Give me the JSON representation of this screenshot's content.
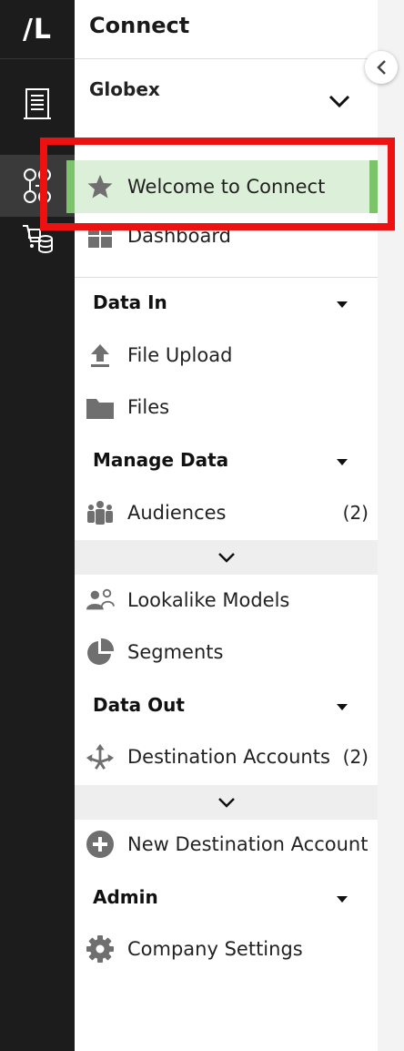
{
  "app": {
    "logo_text": "/L",
    "title": "Connect",
    "org_name": "Globex"
  },
  "rail": {
    "items": [
      {
        "icon": "building-icon"
      },
      {
        "icon": "connect-nodes-icon",
        "active": true
      },
      {
        "icon": "cart-database-icon"
      }
    ]
  },
  "nav": {
    "welcome": {
      "label": "Welcome to Connect",
      "icon": "star-icon"
    },
    "dashboard": {
      "label": "Dashboard",
      "icon": "dashboard-icon"
    },
    "sections": [
      {
        "title": "Data In"
      },
      {
        "title": "Manage Data"
      },
      {
        "title": "Data Out"
      },
      {
        "title": "Admin"
      }
    ],
    "file_upload": {
      "label": "File Upload",
      "icon": "upload-icon"
    },
    "files": {
      "label": "Files",
      "icon": "folder-icon"
    },
    "audiences": {
      "label": "Audiences",
      "count": "(2)",
      "icon": "people-icon"
    },
    "lookalike": {
      "label": "Lookalike Models",
      "icon": "lookalike-icon"
    },
    "segments": {
      "label": "Segments",
      "icon": "pie-icon"
    },
    "destinations": {
      "label": "Destination Accounts",
      "count": "(2)",
      "icon": "share-arrows-icon"
    },
    "new_destination": {
      "label": "New Destination Account",
      "icon": "plus-circle-icon"
    },
    "company_settings": {
      "label": "Company Settings",
      "icon": "gear-icon"
    }
  },
  "colors": {
    "rail_bg": "#1c1c1c",
    "active_bg": "#dcefd8",
    "active_accent": "#7cc46a",
    "highlight": "#ee1111",
    "icon_gray": "#6f6f6f"
  }
}
